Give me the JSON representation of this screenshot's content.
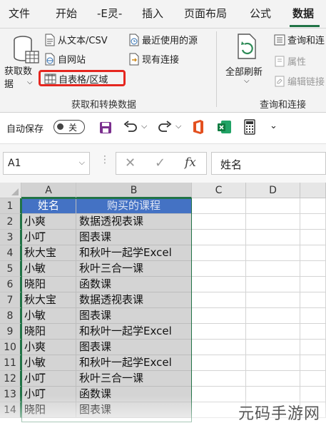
{
  "tabs": [
    "文件",
    "开始",
    "-E灵-",
    "插入",
    "页面布局",
    "公式",
    "数据"
  ],
  "active_tab": "数据",
  "ribbon": {
    "get_data": "获取数据",
    "from_text": "从文本/CSV",
    "from_web": "自网站",
    "from_table": "自表格/区域",
    "recent_sources": "最近使用的源",
    "existing_connections": "现有连接",
    "group1_label": "获取和转换数据",
    "refresh_all": "全部刷新",
    "queries_connections": "查询和连",
    "properties": "属性",
    "edit_links": "编辑链接",
    "group2_label": "查询和连接"
  },
  "qat": {
    "autosave": "自动保存",
    "toggle_state": "关"
  },
  "formula_bar": {
    "name_box": "A1",
    "fx": "fx",
    "formula": "姓名"
  },
  "columns": [
    "A",
    "B",
    "C",
    "D"
  ],
  "table": [
    [
      "姓名",
      "购买的课程"
    ],
    [
      "小爽",
      "数据透视表课"
    ],
    [
      "小叮",
      "图表课"
    ],
    [
      "秋大宝",
      "和秋叶一起学Excel"
    ],
    [
      "小敏",
      "秋叶三合一课"
    ],
    [
      "晓阳",
      "函数课"
    ],
    [
      "秋大宝",
      "数据透视表课"
    ],
    [
      "小敏",
      "图表课"
    ],
    [
      "晓阳",
      "和秋叶一起学Excel"
    ],
    [
      "小爽",
      "图表课"
    ],
    [
      "小敏",
      "和秋叶一起学Excel"
    ],
    [
      "小叮",
      "秋叶三合一课"
    ],
    [
      "小叮",
      "函数课"
    ],
    [
      "晓阳",
      "图表课"
    ]
  ],
  "watermark": "元码手游网",
  "colors": {
    "accent": "#217346",
    "header_fill": "#4472c4",
    "highlight": "#e5261f",
    "selection": "#d4d4d4"
  }
}
